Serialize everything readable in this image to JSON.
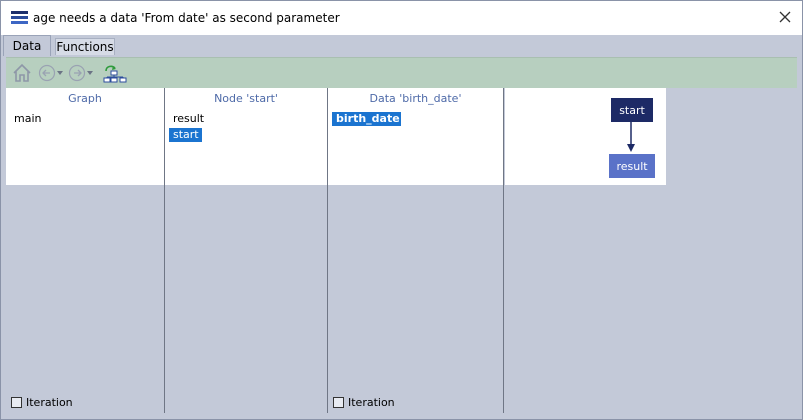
{
  "window": {
    "title": "age needs a data 'From date' as second parameter",
    "close_icon": "close-icon"
  },
  "tabs": [
    {
      "label": "Data",
      "active": true
    },
    {
      "label": "Functions",
      "active": false
    }
  ],
  "toolbar": {
    "icons": [
      "home-icon",
      "back-icon",
      "forward-icon",
      "graph-tree-icon"
    ]
  },
  "columns": {
    "graph": {
      "header": "Graph",
      "items": [
        "main"
      ],
      "iteration_label": "Iteration",
      "iteration_checked": false
    },
    "node": {
      "header": "Node 'start'",
      "items": [
        "result",
        "start"
      ],
      "selected": "start"
    },
    "data": {
      "header": "Data 'birth_date'",
      "items": [
        "birth_date"
      ],
      "selected": "birth_date",
      "iteration_label": "Iteration",
      "iteration_checked": false
    }
  },
  "diagram": {
    "nodes": [
      "start",
      "result"
    ],
    "colors": {
      "start": "#1d2a66",
      "result": "#5a72c8",
      "selection": "#1b74d0",
      "toolbar": "#b7cfbf",
      "header_text": "#4e6aa8"
    }
  }
}
